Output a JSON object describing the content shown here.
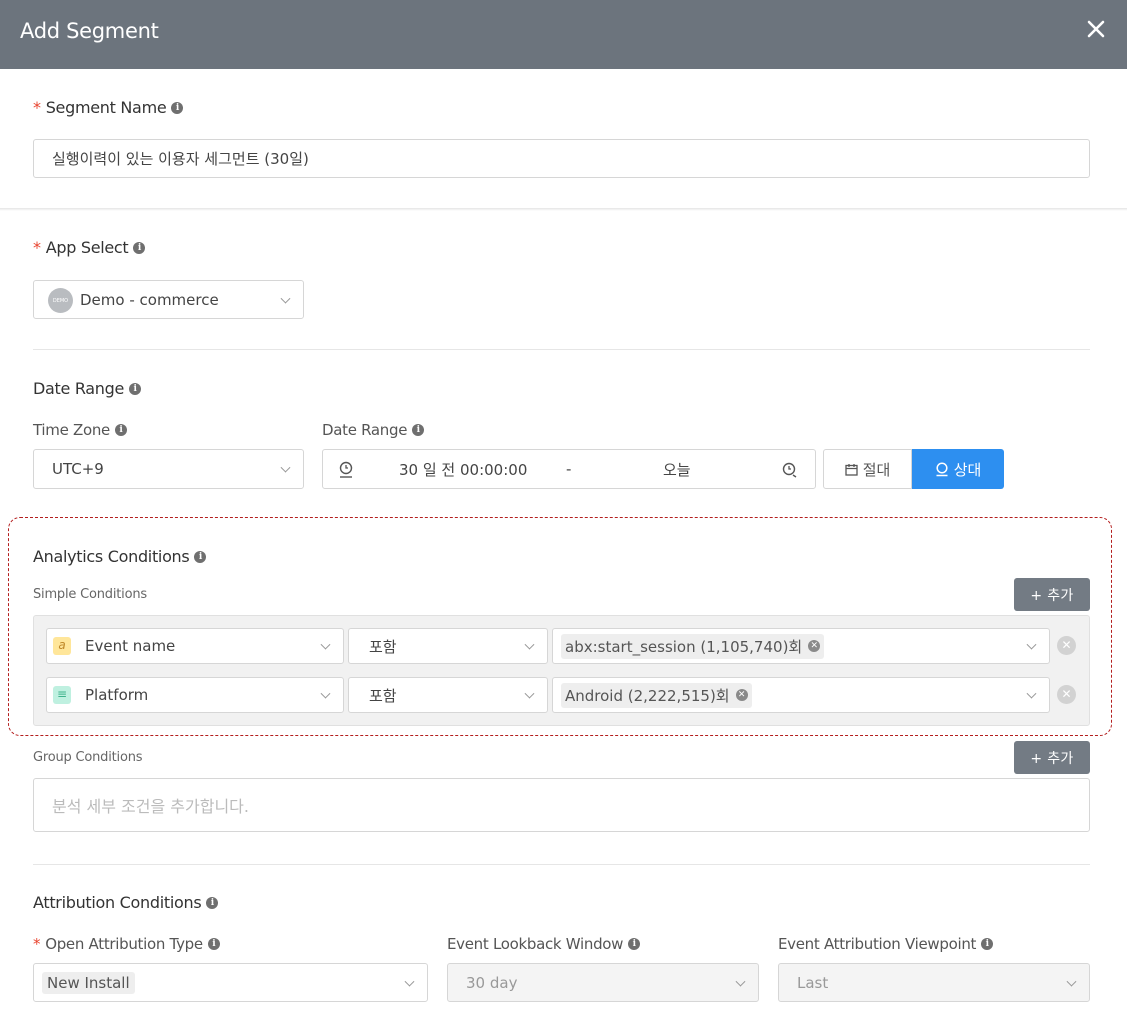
{
  "header": {
    "title": "Add Segment"
  },
  "segment_name": {
    "label": "Segment Name",
    "value": "실행이력이 있는 이용자 세그먼트 (30일)"
  },
  "app_select": {
    "label": "App Select",
    "value": "Demo - commerce",
    "avatar_text": "DEMO"
  },
  "date_range": {
    "section_label": "Date Range",
    "time_zone_label": "Time Zone",
    "time_zone_value": "UTC+9",
    "range_label": "Date Range",
    "start": "30 일 전 00:00:00",
    "separator": "-",
    "end": "오늘",
    "absolute_label": "절대",
    "relative_label": "상대"
  },
  "analytics": {
    "title": "Analytics Conditions",
    "simple_label": "Simple Conditions",
    "add_label": "+ 추가",
    "rows": [
      {
        "icon_text": "a",
        "field": "Event name",
        "op": "포함",
        "tag": "abx:start_session (1,105,740)회"
      },
      {
        "icon_text": "≡",
        "field": "Platform",
        "op": "포함",
        "tag": "Android (2,222,515)회"
      }
    ],
    "group_label": "Group Conditions",
    "group_add_label": "+ 추가",
    "group_placeholder": "분석 세부 조건을 추가합니다."
  },
  "attribution": {
    "title": "Attribution Conditions",
    "open_type_label": "Open Attribution Type",
    "open_type_value": "New Install",
    "lookback_label": "Event Lookback Window",
    "lookback_value": "30 day",
    "viewpoint_label": "Event Attribution Viewpoint",
    "viewpoint_value": "Last"
  },
  "colors": {
    "header_bg": "#6c747d",
    "primary": "#2d8ff0",
    "required": "#e8432e",
    "dashed_highlight": "#b41e1e"
  }
}
